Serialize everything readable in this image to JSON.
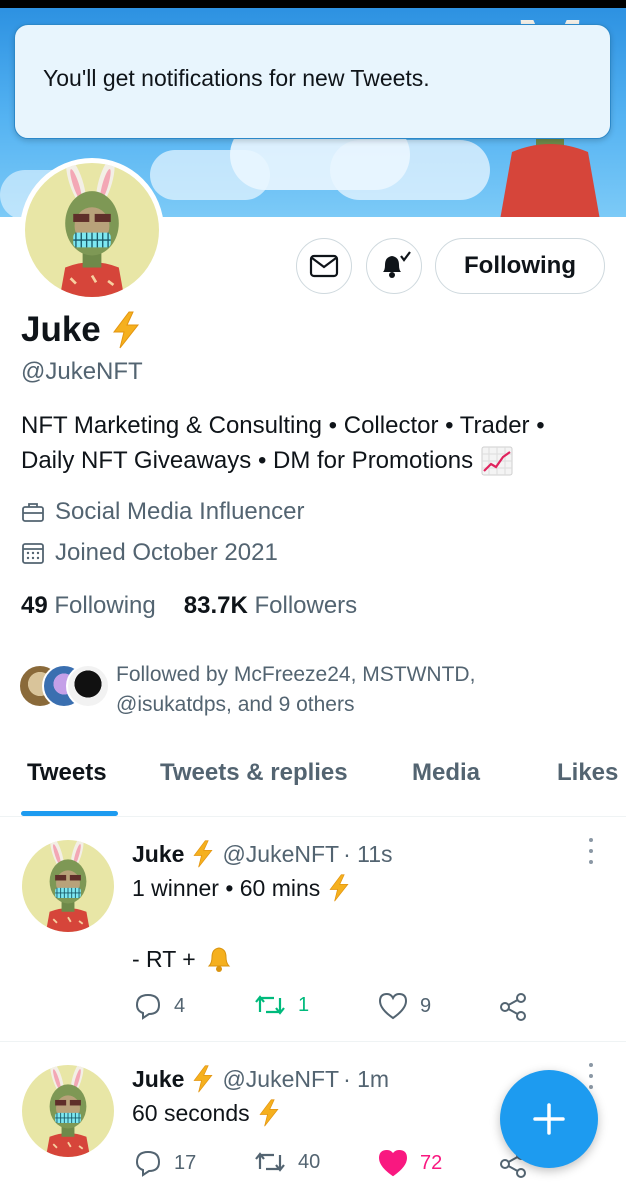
{
  "toast": {
    "message": "You'll get notifications for new Tweets."
  },
  "profile": {
    "name": "Juke",
    "name_emoji": "lightning-bolt-icon",
    "handle": "@JukeNFT",
    "bio_line1": "NFT Marketing & Consulting • Collector • Trader •",
    "bio_line2": "Daily NFT Giveaways • DM for Promotions",
    "bio_emoji": "chart-increasing-icon",
    "category": "Social Media Influencer",
    "joined": "Joined October 2021",
    "following_count": "49",
    "following_label": "Following",
    "followers_count": "83.7K",
    "followers_label": "Followers",
    "followed_by_line1": "Followed by McFreeze24, MSTWNTD,",
    "followed_by_line2": "@isukatdps, and 9 others"
  },
  "actions": {
    "message_icon": "envelope-icon",
    "notify_icon": "bell-check-icon",
    "follow_label": "Following"
  },
  "tabs": [
    {
      "label": "Tweets",
      "active": true
    },
    {
      "label": "Tweets & replies",
      "active": false
    },
    {
      "label": "Media",
      "active": false
    },
    {
      "label": "Likes",
      "active": false
    }
  ],
  "tweets": [
    {
      "name": "Juke",
      "handle": "@JukeNFT",
      "time": "· 11s",
      "line1": "1 winner • 60 mins",
      "line2": "- RT +",
      "replies": "4",
      "retweets": "1",
      "retweeted": true,
      "likes": "9",
      "liked": false
    },
    {
      "name": "Juke",
      "handle": "@JukeNFT",
      "time": "· 1m",
      "line1": "60 seconds",
      "replies": "17",
      "retweets": "40",
      "retweeted": false,
      "likes": "72",
      "liked": true
    }
  ],
  "colors": {
    "accent": "#1d9bf0",
    "retweet_green": "#00ba7c",
    "like_pink": "#f91880",
    "muted": "#536471",
    "lightning": "#f5b01e"
  },
  "fab": {
    "icon": "plus-icon"
  }
}
